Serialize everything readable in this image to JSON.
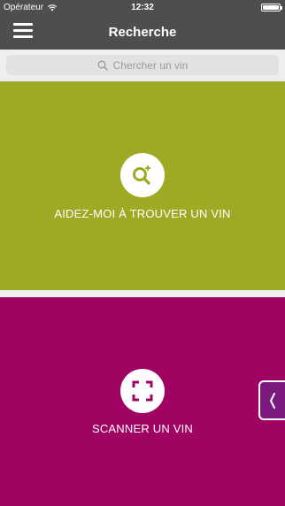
{
  "status_bar": {
    "carrier": "Opérateur",
    "time": "12:32",
    "battery_level": 1.0
  },
  "nav": {
    "menu_icon": "hamburger-menu-icon",
    "title": "Recherche"
  },
  "search": {
    "placeholder": "Chercher un vin",
    "icon": "search-icon"
  },
  "actions": [
    {
      "label": "AIDEZ-MOI À TROUVER UN VIN",
      "icon": "search-plus-icon",
      "color": "#9ea924"
    },
    {
      "label": "SCANNER UN VIN",
      "icon": "scan-frame-icon",
      "color": "#a00462"
    }
  ],
  "side_tab": {
    "icon": "chevron-left-icon",
    "color": "#7a1a7e"
  },
  "colors": {
    "header": "#4e4e4e",
    "background": "#eeeeee"
  }
}
